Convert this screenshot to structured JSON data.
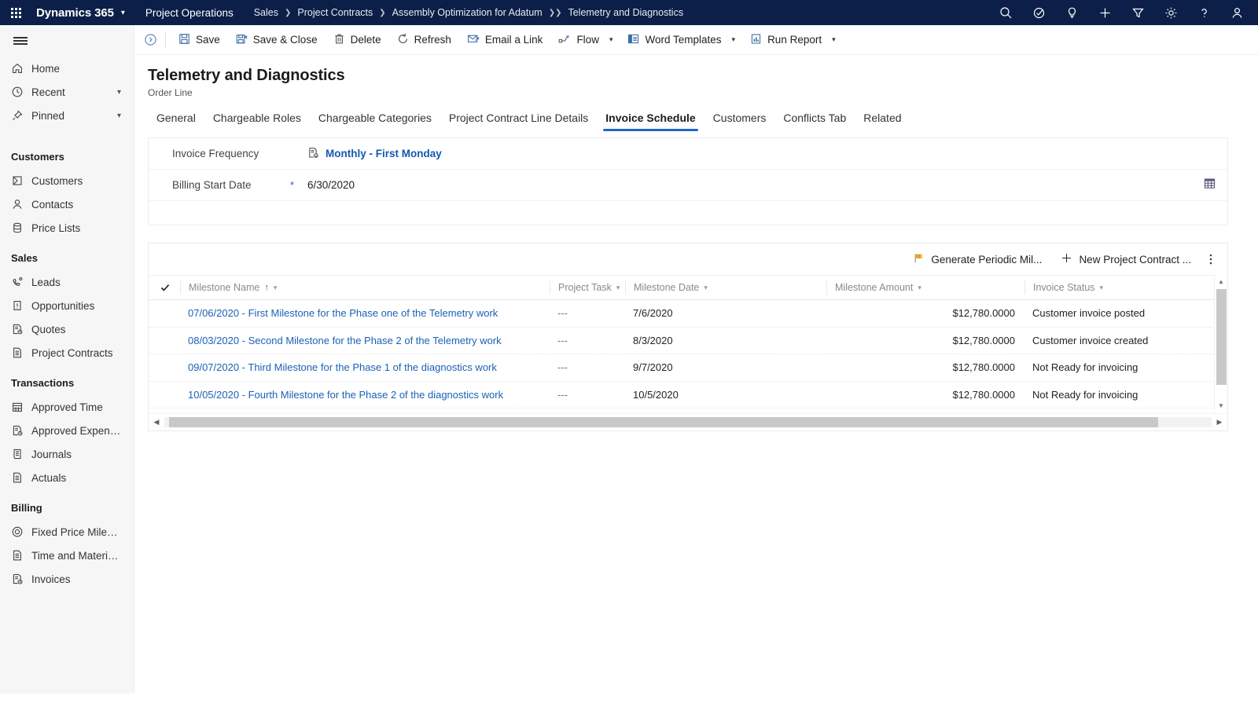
{
  "topbar": {
    "brand": "Dynamics 365",
    "brand_chevron": "chevron-down",
    "app_name": "Project Operations",
    "breadcrumb": [
      {
        "label": "Sales"
      },
      {
        "label": "Project Contracts"
      },
      {
        "label": "Assembly Optimization for Adatum"
      },
      {
        "label": "Telemetry and Diagnostics"
      }
    ],
    "icons": [
      "search-icon",
      "diagnostics-icon",
      "lightbulb-icon",
      "plus-icon",
      "filter-icon",
      "gear-icon",
      "help-icon",
      "user-avatar-icon"
    ],
    "background": "#0b1f48"
  },
  "sidebar": {
    "hamburger_label": "menu-icon",
    "top_items": [
      {
        "label": "Home",
        "icon": "home-icon",
        "chevron": false
      },
      {
        "label": "Recent",
        "icon": "clock-icon",
        "chevron": true
      },
      {
        "label": "Pinned",
        "icon": "pin-icon",
        "chevron": true
      }
    ],
    "groups": [
      {
        "title": "Customers",
        "items": [
          {
            "label": "Customers",
            "icon": "account-icon"
          },
          {
            "label": "Contacts",
            "icon": "contact-icon"
          },
          {
            "label": "Price Lists",
            "icon": "pricelist-icon"
          }
        ]
      },
      {
        "title": "Sales",
        "items": [
          {
            "label": "Leads",
            "icon": "lead-icon"
          },
          {
            "label": "Opportunities",
            "icon": "opportunity-icon"
          },
          {
            "label": "Quotes",
            "icon": "quote-icon"
          },
          {
            "label": "Project Contracts",
            "icon": "document-icon"
          }
        ]
      },
      {
        "title": "Transactions",
        "items": [
          {
            "label": "Approved Time",
            "icon": "calendar-icon"
          },
          {
            "label": "Approved Expenses",
            "icon": "expense-icon"
          },
          {
            "label": "Journals",
            "icon": "journal-icon"
          },
          {
            "label": "Actuals",
            "icon": "document-icon"
          }
        ]
      },
      {
        "title": "Billing",
        "items": [
          {
            "label": "Fixed Price Milestones",
            "icon": "target-icon"
          },
          {
            "label": "Time and Material Bil...",
            "icon": "document-icon"
          },
          {
            "label": "Invoices",
            "icon": "invoice-icon"
          }
        ]
      }
    ]
  },
  "commandbar": {
    "overflow_icon": "chevron-circle-icon",
    "buttons": [
      {
        "label": "Save",
        "icon": "save-icon",
        "chevron": false
      },
      {
        "label": "Save & Close",
        "icon": "save-close-icon",
        "chevron": false
      },
      {
        "label": "Delete",
        "icon": "trash-icon",
        "chevron": false
      },
      {
        "label": "Refresh",
        "icon": "refresh-icon",
        "chevron": false
      },
      {
        "label": "Email a Link",
        "icon": "email-link-icon",
        "chevron": false
      },
      {
        "label": "Flow",
        "icon": "flow-icon",
        "chevron": true
      },
      {
        "label": "Word Templates",
        "icon": "word-icon",
        "chevron": true
      },
      {
        "label": "Run Report",
        "icon": "report-icon",
        "chevron": true
      }
    ]
  },
  "page": {
    "title": "Telemetry and Diagnostics",
    "subtitle": "Order Line",
    "tabs": [
      {
        "label": "General",
        "active": false
      },
      {
        "label": "Chargeable Roles",
        "active": false
      },
      {
        "label": "Chargeable Categories",
        "active": false
      },
      {
        "label": "Project Contract Line Details",
        "active": false
      },
      {
        "label": "Invoice Schedule",
        "active": true
      },
      {
        "label": "Customers",
        "active": false
      },
      {
        "label": "Conflicts Tab",
        "active": false
      },
      {
        "label": "Related",
        "active": false
      }
    ],
    "accent_color": "#2266cc"
  },
  "form": {
    "invoice_frequency": {
      "label": "Invoice Frequency",
      "value": "Monthly - First Monday",
      "icon": "record-lookup-icon"
    },
    "billing_start_date": {
      "label": "Billing Start Date",
      "required_marker": "*",
      "value": "6/30/2020",
      "calendar_icon": "calendar-icon"
    }
  },
  "grid": {
    "toolbar": [
      {
        "label": "Generate Periodic Mil...",
        "icon": "flag-icon"
      },
      {
        "label": "New Project Contract ...",
        "icon": "plus-icon"
      }
    ],
    "more_commands_icon": "more-vertical-icon",
    "select_all_icon": "checkmark-icon",
    "columns": [
      {
        "label": "Milestone Name",
        "sorted": "ascending",
        "sort_glyph": "↑"
      },
      {
        "label": "Project Task",
        "sorted": ""
      },
      {
        "label": "Milestone Date",
        "sorted": ""
      },
      {
        "label": "Milestone Amount",
        "sorted": ""
      },
      {
        "label": "Invoice Status",
        "sorted": ""
      }
    ],
    "rows": [
      {
        "name": "07/06/2020 - First Milestone for the Phase one of the Telemetry work",
        "task": "---",
        "date": "7/6/2020",
        "amount": "$12,780.0000",
        "status": "Customer invoice posted"
      },
      {
        "name": "08/03/2020 - Second Milestone for the Phase 2 of the Telemetry work",
        "task": "---",
        "date": "8/3/2020",
        "amount": "$12,780.0000",
        "status": "Customer invoice created"
      },
      {
        "name": "09/07/2020 -  Third Milestone for the Phase 1 of the diagnostics work",
        "task": "---",
        "date": "9/7/2020",
        "amount": "$12,780.0000",
        "status": "Not Ready for invoicing"
      },
      {
        "name": "10/05/2020 -  Fourth Milestone for the Phase 2 of the diagnostics work",
        "task": "---",
        "date": "10/5/2020",
        "amount": "$12,780.0000",
        "status": "Not Ready for invoicing"
      }
    ],
    "scrollbars": {
      "vertical_up_icon": "caret-up-icon",
      "vertical_down_icon": "caret-down-icon",
      "horizontal_left_icon": "caret-left-icon",
      "horizontal_right_icon": "caret-right-icon"
    }
  }
}
